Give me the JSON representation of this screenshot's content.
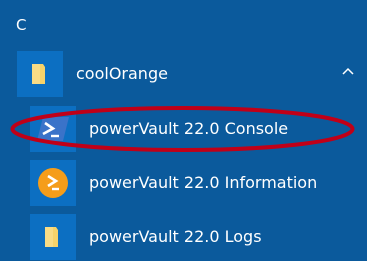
{
  "section_letter": "C",
  "folder": {
    "name": "coolOrange",
    "icon": "folder-icon",
    "expanded": true
  },
  "apps": [
    {
      "label": "powerVault 22.0 Console",
      "icon": "powershell-icon"
    },
    {
      "label": "powerVault 22.0 Information",
      "icon": "info-prompt-icon"
    },
    {
      "label": "powerVault 22.0 Logs",
      "icon": "folder-icon"
    }
  ],
  "colors": {
    "background": "#0b5a9c",
    "tile": "#0c6fc2",
    "folder": "#f7d36a",
    "powershell": "#3a73c9",
    "info": "#f59d1a",
    "annotation": "#c00018"
  }
}
